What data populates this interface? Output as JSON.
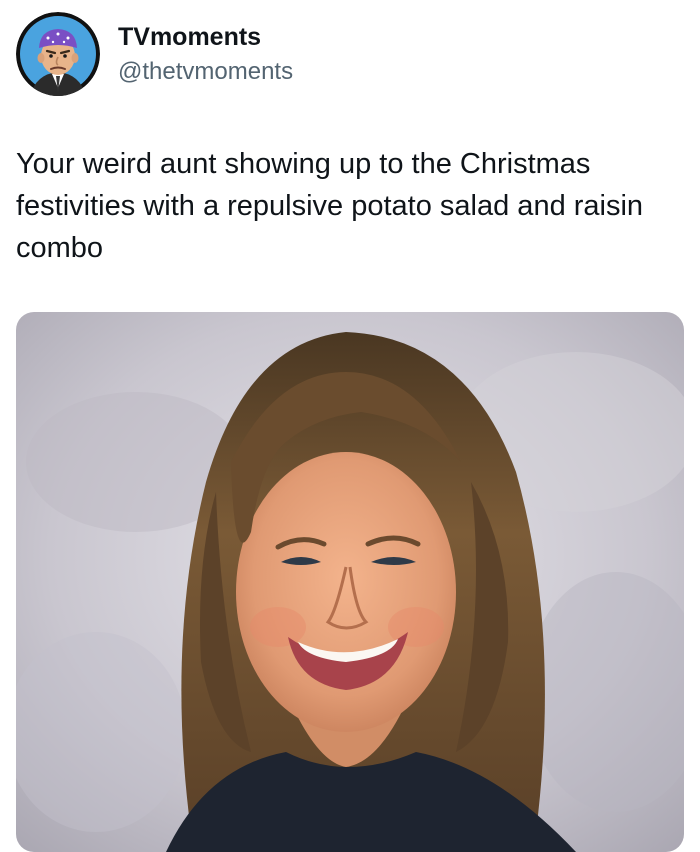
{
  "tweet": {
    "display_name": "TVmoments",
    "handle": "@thetvmoments",
    "text": "Your weird aunt showing up to the Christmas festivities with a repulsive potato salad and raisin combo",
    "media_description": "photo"
  },
  "icons": {
    "avatar": "profile-avatar-icon"
  },
  "colors": {
    "handle": "#536471",
    "text": "#0f1419",
    "avatar_bg": "#4aa3df",
    "bandana": "#7a4fc4"
  }
}
